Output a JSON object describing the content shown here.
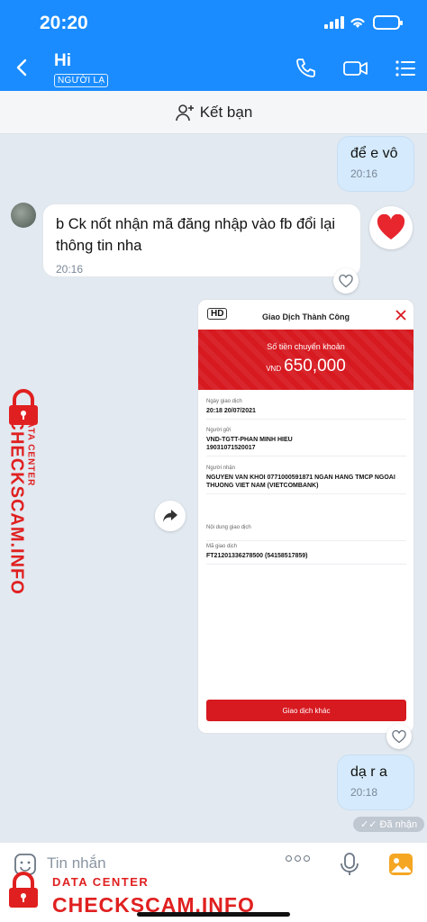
{
  "status_bar": {
    "time": "20:20"
  },
  "header": {
    "title": "Hi",
    "badge": "NGƯỜI LẠ",
    "icons": [
      "back-icon",
      "phone-icon",
      "video-call-icon",
      "menu-icon"
    ]
  },
  "friend_bar": {
    "label": "Kết bạn",
    "icon": "add-user-icon"
  },
  "messages": [
    {
      "direction": "out",
      "text": "để e vô",
      "time": "20:16"
    },
    {
      "direction": "in",
      "text": "b Ck nốt nhận mã đăng nhập vào fb đổi lại thông tin nha",
      "time": "20:16",
      "reaction": "heart"
    },
    {
      "direction": "out",
      "type": "image"
    },
    {
      "direction": "out",
      "text": "dạ r a",
      "time": "20:18"
    }
  ],
  "receipt": {
    "hd_label": "HD",
    "title": "Giao Dịch Thành Công",
    "amount_label": "Số tiền chuyển khoản",
    "currency": "VND",
    "amount": "650,000",
    "fields": [
      {
        "label": "Ngày giao dịch",
        "value": "20:18 20/07/2021"
      },
      {
        "label": "Người gửi",
        "value": "VND-TGTT-PHAN MINH HIEU 19031071520017"
      },
      {
        "label": "Người nhận",
        "value": "NGUYEN VAN KHOI 0771000591871 NGAN HANG TMCP NGOAI THUONG VIET NAM (VIETCOMBANK)"
      },
      {
        "label": "Nội dung giao dịch",
        "value": ""
      },
      {
        "label": "Mã giao dịch",
        "value": "FT21201336278500 (54158517859)"
      }
    ],
    "button": "Giao dịch khác"
  },
  "seen_status": "Đã nhận",
  "input": {
    "placeholder": "Tin nhắn"
  },
  "watermark": {
    "small": "DATA CENTER",
    "big": "CHECKSCAM.INFO"
  },
  "colors": {
    "header_blue": "#1a8cff",
    "bank_red": "#d71920",
    "watermark_red": "#e02020",
    "outgoing_bubble": "#d5ebfd"
  }
}
